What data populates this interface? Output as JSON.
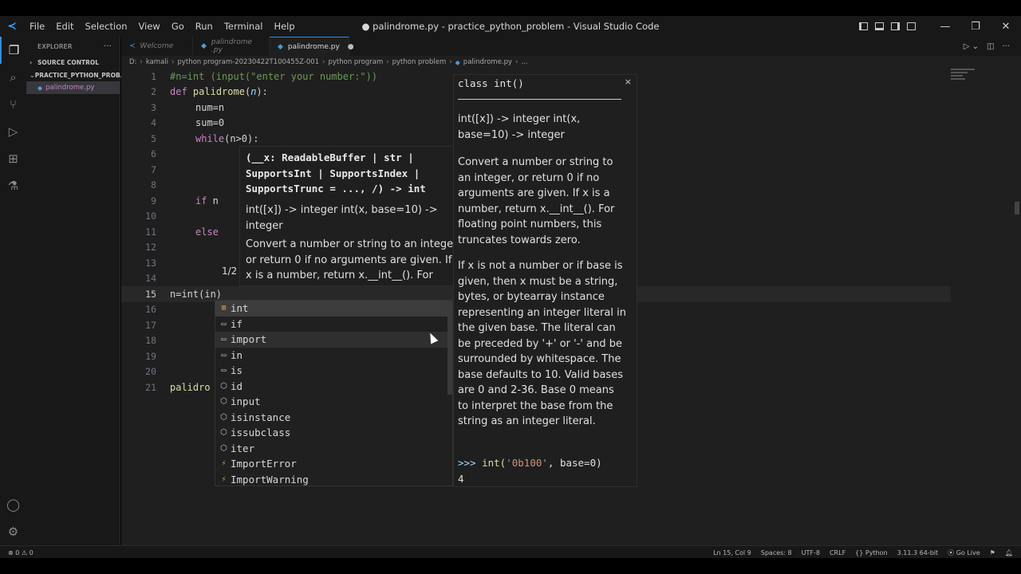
{
  "window": {
    "title": "● palindrome.py - practice_python_problem - Visual Studio Code",
    "menu": [
      "File",
      "Edit",
      "Selection",
      "View",
      "Go",
      "Run",
      "Terminal",
      "Help"
    ],
    "logo": "vscode-logo",
    "controls": {
      "minimize": "—",
      "maximize": "❐",
      "close": "✕"
    }
  },
  "sidebar": {
    "header": "EXPLORER",
    "more": "···",
    "source_control": "SOURCE CONTROL",
    "folder": "PRACTICE_PYTHON_PROB...",
    "file": "palindrome.py"
  },
  "tabs": [
    {
      "label": "Welcome",
      "active": false
    },
    {
      "label": "palindrome .py",
      "active": false
    },
    {
      "label": "palindrome.py",
      "active": true,
      "dirty": true
    }
  ],
  "breadcrumb": [
    "D:",
    "kamali",
    "python program-20230422T100455Z-001",
    "python program",
    "python problem",
    "palindrome.py",
    "..."
  ],
  "code": {
    "line_numbers": [
      "1",
      "2",
      "3",
      "4",
      "5",
      "6",
      "7",
      "8",
      "9",
      "10",
      "11",
      "12",
      "13",
      "14",
      "15",
      "16",
      "17",
      "18",
      "19",
      "20",
      "21"
    ],
    "current_line": 15,
    "line1": "#n=int (input(\"enter your number:\"))",
    "line2_kw": "def",
    "line2_fn": "palidrome",
    "line2_param": "n",
    "line3": "num=n",
    "line4": "sum=0",
    "line5_kw": "while",
    "line5_rest": "(n>0):",
    "line9_kw": "if",
    "line9_rest": " n",
    "line11_kw": "else",
    "line15": "n=int(in)",
    "line21": "palidro"
  },
  "signature_help": {
    "signature": "(__x: ReadableBuffer | str |\nSupportsInt | SupportsIndex |\nSupportsTrunc = ..., /) -> int",
    "summary": "int([x]) -> integer int(x, base=10) -> integer",
    "description": "Convert a number or string to an integer or return 0 if no arguments are given. If x is a number, return x.__int__(). For floating",
    "counter": "1/2"
  },
  "suggestions": [
    {
      "label": "int",
      "icon": "class-icon",
      "selected": true
    },
    {
      "label": "if",
      "icon": "keyword-icon"
    },
    {
      "label": "import",
      "icon": "keyword-icon",
      "hovered": true
    },
    {
      "label": "in",
      "icon": "keyword-icon"
    },
    {
      "label": "is",
      "icon": "keyword-icon"
    },
    {
      "label": "id",
      "icon": "function-icon"
    },
    {
      "label": "input",
      "icon": "function-icon"
    },
    {
      "label": "isinstance",
      "icon": "function-icon"
    },
    {
      "label": "issubclass",
      "icon": "function-icon"
    },
    {
      "label": "iter",
      "icon": "function-icon"
    },
    {
      "label": "ImportError",
      "icon": "class-icon"
    },
    {
      "label": "ImportWarning",
      "icon": "class-icon"
    }
  ],
  "docs": {
    "title": "class int()",
    "close": "×",
    "p1": "int([x]) -> integer int(x, base=10) -> integer",
    "p2": "Convert a number or string to an integer, or return 0 if no arguments are given. If x is a number, return x.__int__(). For floating point numbers, this truncates towards zero.",
    "p3": "If x is not a number or if base is given, then x must be a string, bytes, or bytearray instance representing an integer literal in the given base. The literal can be preceded by '+' or '-' and be surrounded by whitespace. The base defaults to 10. Valid bases are 0 and 2-36. Base 0 means to interpret the base from the string as an integer literal.",
    "example_prompt": ">>> ",
    "example_fn": "int(",
    "example_str": "'0b100'",
    "example_rest": ", base=0)",
    "example_result": "4"
  },
  "statusbar": {
    "problems": "⊗ 0 ⚠ 0",
    "position": "Ln 15, Col 9",
    "spaces": "Spaces: 8",
    "encoding": "UTF-8",
    "eol": "CRLF",
    "language": "Python",
    "interpreter": "3.11.3 64-bit",
    "golive": "Go Live"
  },
  "colors": {
    "accent": "#2f8de0",
    "editor_bg": "#1f1f1f",
    "chrome_bg": "#181818",
    "keyword": "#c586c0",
    "function": "#dcdcaa",
    "number": "#b5cea8",
    "comment": "#6a9955"
  }
}
